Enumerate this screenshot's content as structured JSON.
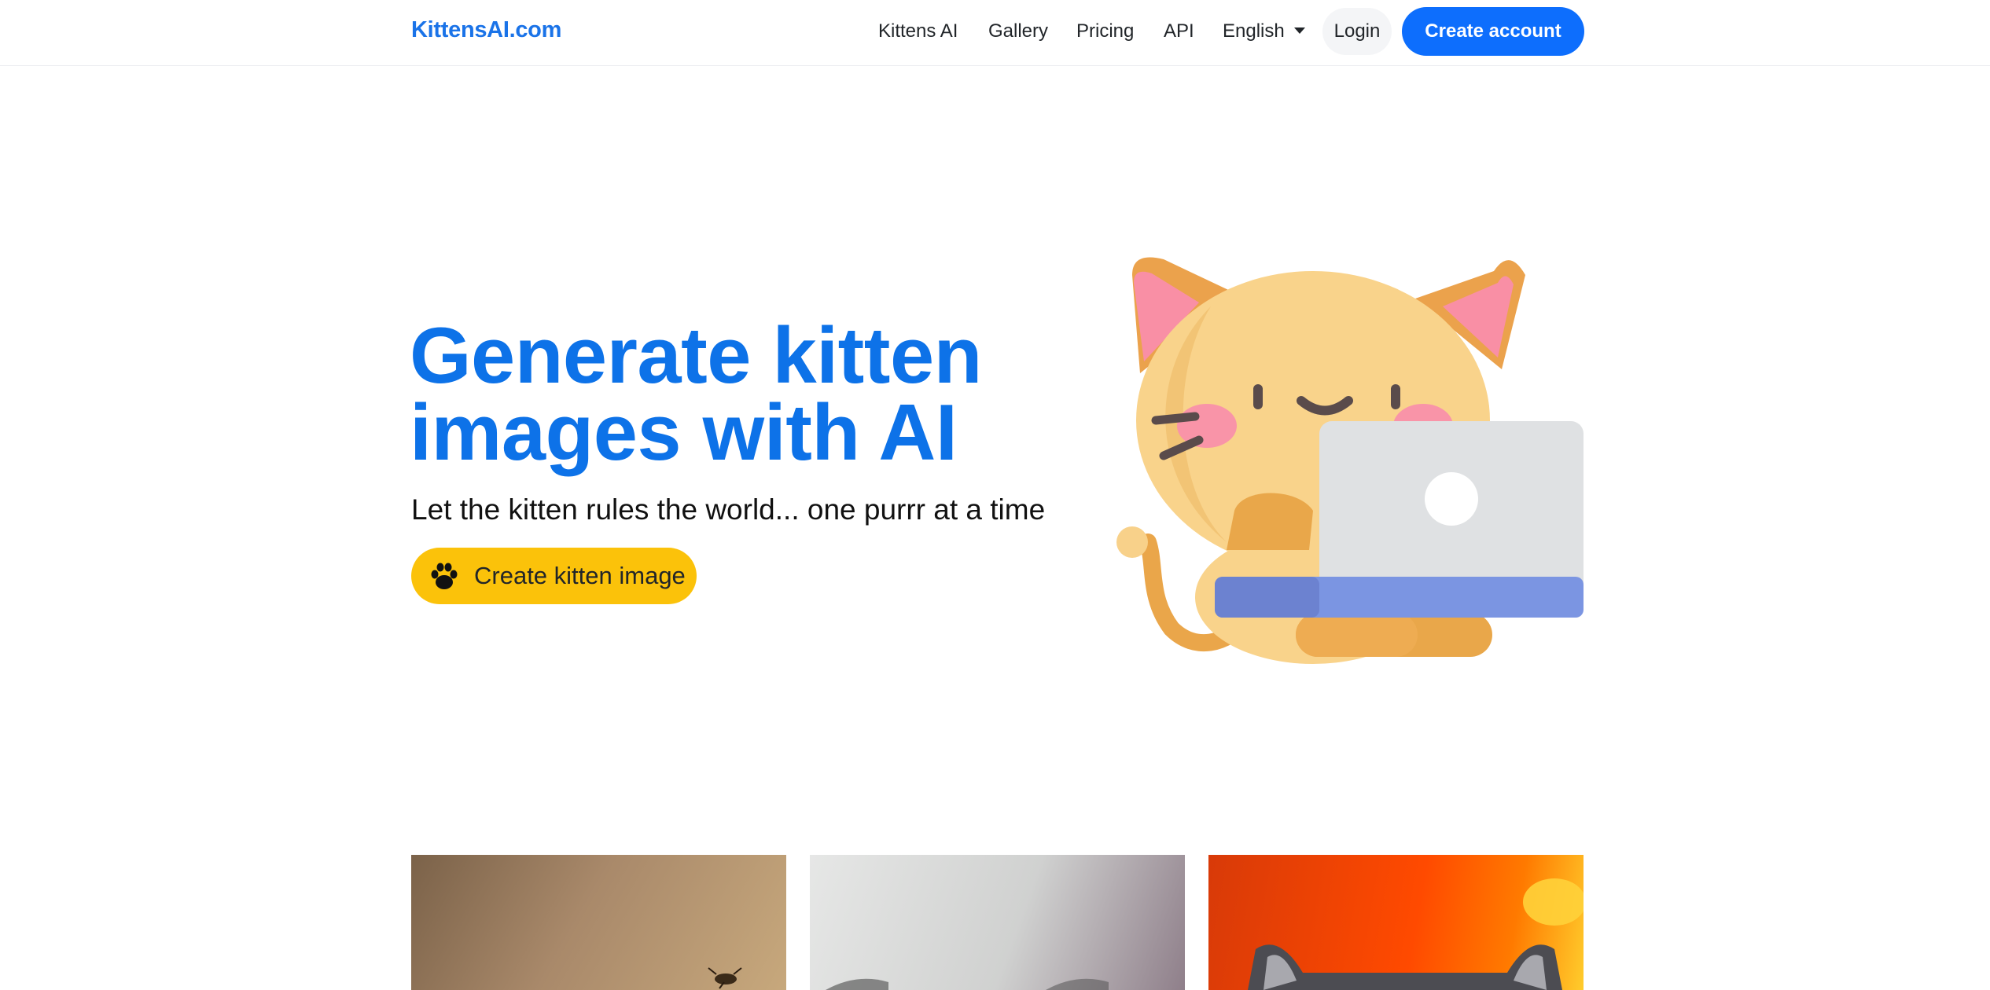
{
  "navbar": {
    "brand": "KittensAI.com",
    "links": [
      {
        "label": "Kittens AI"
      },
      {
        "label": "Gallery"
      },
      {
        "label": "Pricing"
      },
      {
        "label": "API"
      }
    ],
    "language": "English",
    "login_label": "Login",
    "create_account_label": "Create account"
  },
  "hero": {
    "title_line1": "Generate kitten",
    "title_line2": "images with AI",
    "subtitle": "Let the kitten rules the world... one purrr at a time",
    "cta_label": "Create kitten image",
    "cta_icon": "paw-icon",
    "illustration": "kitten-with-laptop"
  },
  "gallery": {
    "items": [
      {
        "subject": "insect-on-amber-background"
      },
      {
        "subject": "white-kitten-on-grey-background"
      },
      {
        "subject": "grey-kitten-on-orange-background"
      }
    ]
  },
  "colors": {
    "brand_blue": "#0d72e8",
    "primary_button": "#0d6efd",
    "cta_yellow": "#fbc20a"
  }
}
